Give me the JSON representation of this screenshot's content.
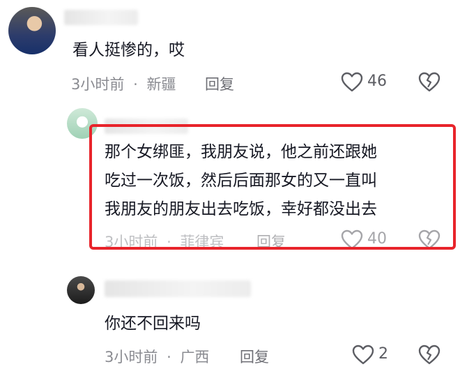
{
  "comments": [
    {
      "text_lines": [
        "看人挺惨的，哎"
      ],
      "time": "3小时前",
      "separator": "·",
      "location": "新疆",
      "reply_label": "回复",
      "like_count": "46"
    },
    {
      "text_lines": [
        "那个女绑匪，我朋友说，他之前还跟她",
        "吃过一次饭，然后后面那女的又一直叫",
        "我朋友的朋友出去吃饭，幸好都没出去"
      ],
      "time": "3小时前",
      "separator": "·",
      "location": "菲律宾",
      "reply_label": "回复",
      "like_count": "40"
    },
    {
      "text_lines": [
        "你还不回来吗"
      ],
      "time": "3小时前",
      "separator": "·",
      "location": "广西",
      "reply_label": "回复",
      "like_count": "2"
    }
  ],
  "icons": {
    "like": "heart-outline-icon",
    "dislike": "broken-heart-icon"
  },
  "colors": {
    "highlight_border": "#e8242b",
    "meta_text": "#8a8b91",
    "body_text": "#161823"
  }
}
